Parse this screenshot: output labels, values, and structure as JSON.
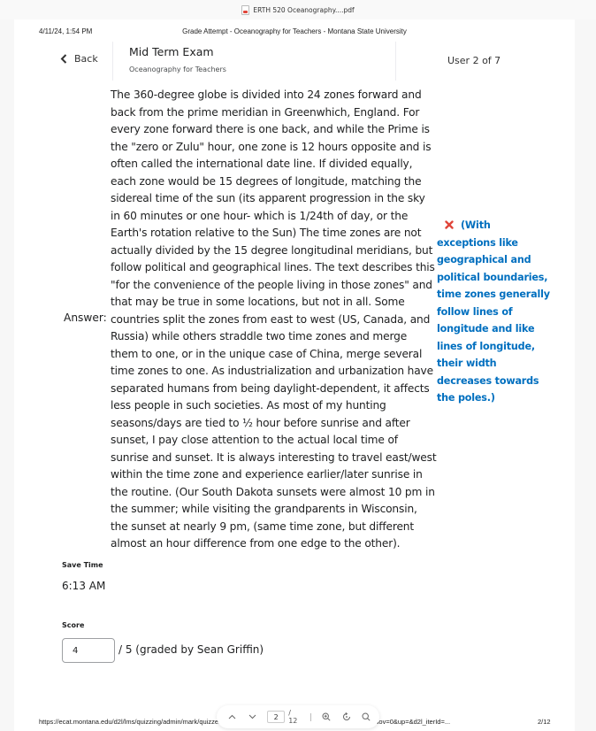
{
  "viewer": {
    "file_name": "ERTH 520 Oceanography....pdf",
    "file_icon": "pdf-file-icon",
    "toolbar": {
      "current_page": "2",
      "total_pages": "/ 12",
      "icons": [
        "chevron-up-icon",
        "chevron-down-icon",
        "zoom-in-icon",
        "rotate-icon",
        "search-icon"
      ]
    }
  },
  "print_header": {
    "date": "4/11/24, 1:54 PM",
    "title": "Grade Attempt - Oceanography for Teachers - Montana State University"
  },
  "nav": {
    "back_label": "Back",
    "exam_title": "Mid Term Exam",
    "course_name": "Oceanography for Teachers",
    "user_position": "User 2 of 7"
  },
  "answer": {
    "label": "Answer:",
    "text": "The 360-degree globe is divided into 24 zones forward and back from the prime meridian in Greenwhich, England. For every zone forward there is one back, and while the Prime is the \"zero or Zulu\" hour, one zone is 12 hours opposite and is often called the international date line. If divided equally, each zone would be 15 degrees of longitude, matching the sidereal time of the sun (its apparent progression in the sky in 60 minutes or one hour- which is 1/24th of day, or the Earth's rotation relative to the Sun) The time zones are not actually divided by the 15 degree longitudinal meridians, but follow political and geographical lines. The text describes this \"for the convenience of the people living in those zones\" and that may be true in some locations, but not in all. Some countries split the zones from east to west (US, Canada, and Russia) while others straddle two time zones and merge them to one, or in the unique case of China, merge several time zones to one. As industrialization and urbanization have separated humans from being daylight-dependent, it affects less people in such societies. As most of my hunting seasons/days are tied to ½ hour before sunrise and after sunset, I pay close attention to the actual local time of sunrise and sunset. It is always interesting to travel east/west within the time zone and experience earlier/later sunrise in the routine. (Our South Dakota sunsets were almost 10 pm in the summer; while visiting the grandparents in Wisconsin, the sunset at nearly 9 pm, (same time zone, but different almost an hour difference from one edge to the other).",
    "feedback_icon": "incorrect-x-icon",
    "feedback_text": "(With exceptions like geographical and political boundaries, time zones generally follow lines of longitude and like lines of longitude, their width decreases towards the poles.)"
  },
  "save_time": {
    "label": "Save Time",
    "value": "6:13 AM"
  },
  "score": {
    "label": "Score",
    "value": "4",
    "suffix": "/ 5  (graded by  Sean Griffin)"
  },
  "print_footer": {
    "url": "https://ecat.montana.edu/d2l/lms/quizzing/admin/mark/quizzes_manage_attempts_grade.d2l?ou=8777778&cft=u&isov=0&up=&d2l_iterId=...",
    "page": "2/12"
  },
  "colors": {
    "feedback": "#006fbf",
    "incorrect": "#e0453a"
  }
}
